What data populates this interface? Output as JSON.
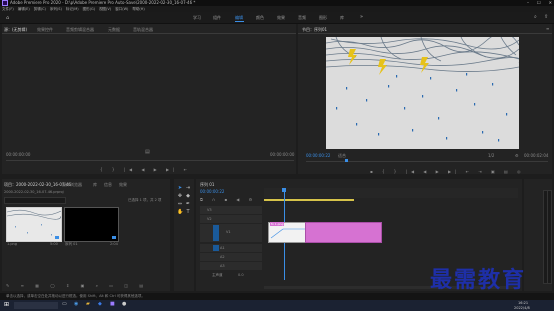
{
  "titlebar": {
    "app_title": "Adobe Premiere Pro 2020 - D:\\p\\Adobe Premiere Pro Auto-Save\\2000-2022-02-30_16-07-46 *"
  },
  "menu": [
    "文件(F)",
    "编辑(E)",
    "剪辑(C)",
    "序列(S)",
    "标记(M)",
    "图形(G)",
    "视图(V)",
    "窗口(W)",
    "帮助(H)"
  ],
  "workspaces": [
    "学习",
    "组件",
    "编辑",
    "颜色",
    "效果",
    "音频",
    "图形",
    "库"
  ],
  "workspace_active": "编辑",
  "source_tabs": [
    "源：(无剪辑)",
    "效果控件",
    "音频剪辑混合器",
    "元数据",
    "音轨混合器"
  ],
  "program": {
    "title": "节目：序列01",
    "timecode": "00:00:00:22",
    "fit": "适合",
    "quality": "1/2",
    "duration": "00:00:02:04"
  },
  "source": {
    "tc_left": "00:00:00:00",
    "tc_right": "00:00:00:00"
  },
  "project": {
    "tabs": [
      "项目：2000-2022-02-30_16-07-46",
      "媒体浏览器",
      "库",
      "信息",
      "效果"
    ],
    "path": "2000-2022-02-30_16-07-46.prproj",
    "count": "已选择 1 项，共 2 项",
    "items": [
      {
        "name": "1.png",
        "dur": "5:00"
      },
      {
        "name": "序列 01",
        "dur": "2:04"
      }
    ]
  },
  "timeline": {
    "title": "序列 01",
    "timecode": "00:00:00:22",
    "tracks": [
      "V3",
      "V2",
      "V1",
      "A1",
      "A2",
      "A3",
      "主声道"
    ],
    "clip_label": "fx 1.png",
    "master_value": "0.0"
  },
  "status": {
    "text": "单击以选择，或单击空白处并拖动以进行框选。使用 Shift、Alt 和 Ctrl 可获得其他选项。"
  },
  "taskbar": {
    "time": "16:21",
    "date": "2022/4/8"
  },
  "watermark": "最需教育"
}
